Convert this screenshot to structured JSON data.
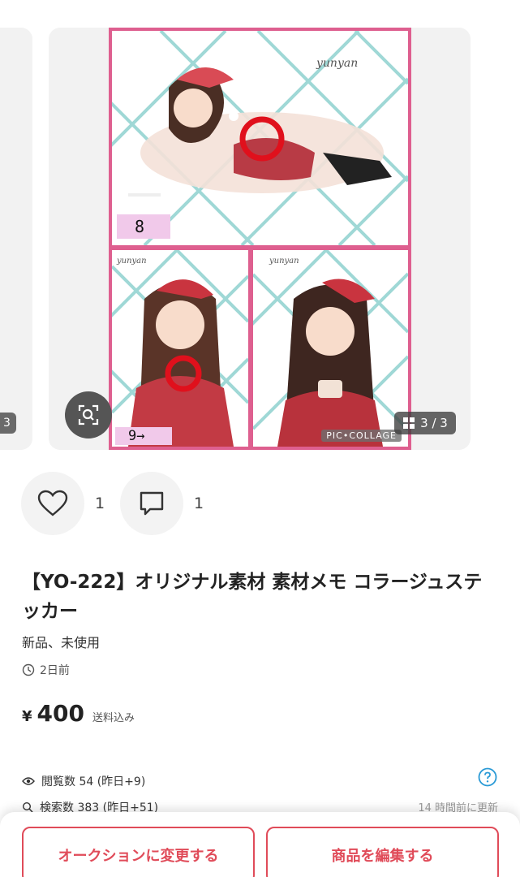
{
  "carousel": {
    "prev_counter": "3",
    "counter": "3 / 3",
    "watermark_text": "yunyan",
    "label_8": "8",
    "label_9": "9→",
    "collage_badge": "PIC•COLLAGE"
  },
  "social": {
    "like_count": "1",
    "comment_count": "1"
  },
  "item": {
    "title": "【YO-222】オリジナル素材 素材メモ コラージュステッカー",
    "condition": "新品、未使用",
    "posted": "2日前",
    "price_symbol": "¥",
    "price": "400",
    "shipping_note": "送料込み"
  },
  "stats": {
    "views": "閲覧数  54 (昨日+9)",
    "searches": "検索数  383 (昨日+51)",
    "updated": "14 時間前に更新"
  },
  "actions": {
    "auction_label": "オークションに変更する",
    "edit_label": "商品を編集する"
  },
  "colors": {
    "accent": "#e04b59",
    "frame": "#de5f8f",
    "grid_lines": "#9fd8d6",
    "help_icon": "#2a9ad6"
  }
}
